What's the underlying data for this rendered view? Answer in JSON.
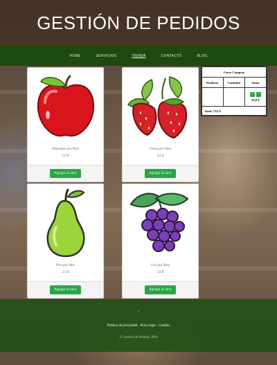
{
  "site": {
    "title": "GESTIÓN DE PEDIDOS"
  },
  "nav": {
    "items": [
      {
        "label": "HOME"
      },
      {
        "label": "SERVICIOS"
      },
      {
        "label": "TIENDA",
        "active": true
      },
      {
        "label": "CONTACTO"
      },
      {
        "label": "BLOG"
      }
    ]
  },
  "products": [
    {
      "name": "Manzanas por libra",
      "price": "5,0 $",
      "button": "Agregar al carro",
      "icon": "apple-icon"
    },
    {
      "name": "Fresas por libra",
      "price": "3,5 $",
      "button": "Agregar al carro",
      "icon": "strawberry-icon"
    },
    {
      "name": "Pera por libra",
      "price": "2,5 $",
      "button": "Agregar al carro",
      "icon": "pear-icon"
    },
    {
      "name": "Uva por libra",
      "price": "3,0 $",
      "button": "Agregar al carro",
      "icon": "grapes-icon"
    }
  ],
  "cart": {
    "title": "Carro Compras",
    "columns": [
      "Producto",
      "Cantidad",
      "Suma"
    ],
    "row": {
      "plus": "+",
      "minus": "-",
      "sum": "50,0 $"
    },
    "total": "Total: 73,0 $"
  },
  "footer": {
    "mark": "=",
    "links": [
      "Política de privacidad",
      "Aviso legal",
      "Cookies"
    ],
    "separator": "·",
    "copyright": "© Gestión de Pedidos 2020"
  },
  "colors": {
    "nav_bg": "#1d4a0f",
    "button_green": "#28a745",
    "footer_bg": "#1e5014"
  }
}
